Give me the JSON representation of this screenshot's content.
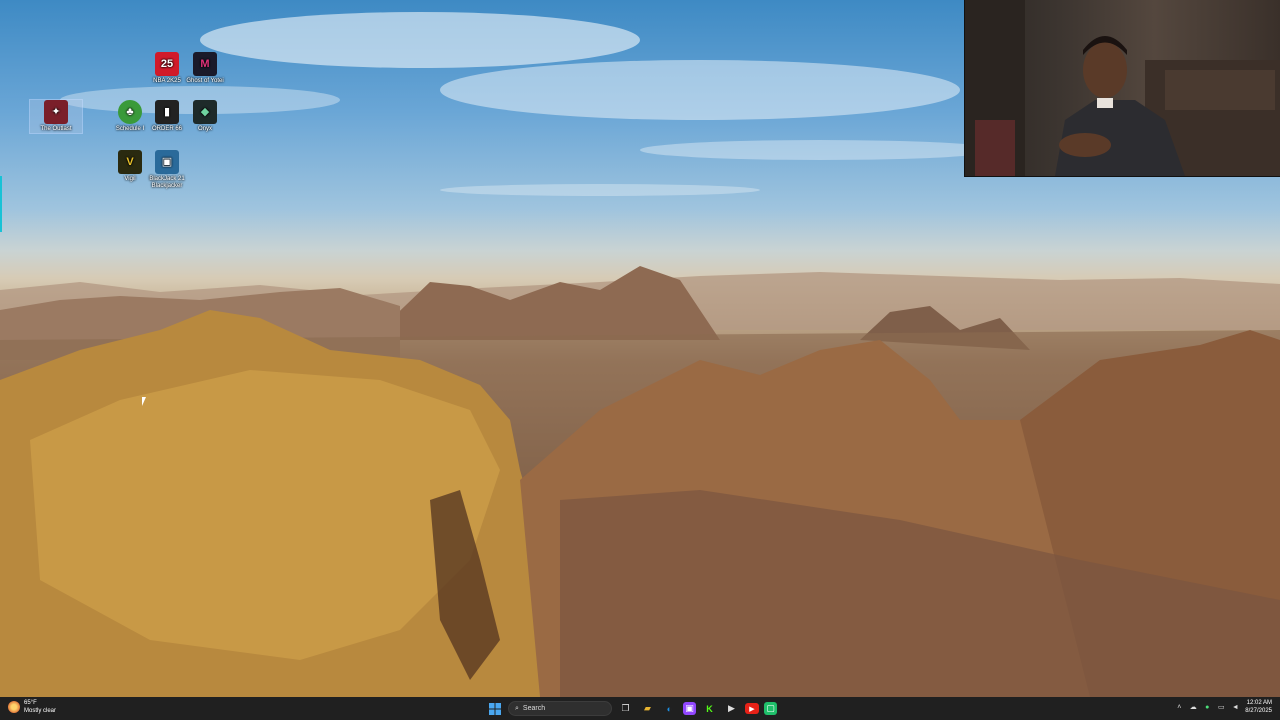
{
  "desktop": {
    "icons": [
      {
        "id": "nba2k25",
        "label": "NBA 2K25",
        "glyph": "25",
        "color": "#d11a2a"
      },
      {
        "id": "ghost",
        "label": "Ghost of Yotei",
        "glyph": "M",
        "color": "#1a1a2a"
      },
      {
        "id": "the-outlast",
        "label": "The Outlast",
        "glyph": "✦",
        "color": "#7a1f2a"
      },
      {
        "id": "schedule",
        "label": "Schedule I",
        "glyph": "♣",
        "color": "#3a9a3a"
      },
      {
        "id": "order66",
        "label": "ORDER 66",
        "glyph": "▮",
        "color": "#222"
      },
      {
        "id": "onyx",
        "label": "Onyx",
        "glyph": "◆",
        "color": "#1e2a2a"
      },
      {
        "id": "vigil",
        "label": "Vigil",
        "glyph": "V",
        "color": "#2a2a10"
      },
      {
        "id": "blackjack",
        "label": "BlackJack 21 Blackjacker",
        "glyph": "▣",
        "color": "#2a6a9a"
      }
    ]
  },
  "taskbar": {
    "weather": {
      "temp": "65°F",
      "condition": "Mostly clear"
    },
    "search_placeholder": "Search",
    "pinned": [
      {
        "id": "task-view",
        "glyph": "❐",
        "color": "#3a3a3a",
        "fg": "#ddd"
      },
      {
        "id": "file-explorer",
        "glyph": "▰",
        "color": "#e8b430",
        "fg": "#e8b430"
      },
      {
        "id": "edge",
        "glyph": "◐",
        "color": "#1d8ee0",
        "fg": "#1d8ee0"
      },
      {
        "id": "twitch",
        "glyph": "▣",
        "color": "#9146ff",
        "fg": "#fff"
      },
      {
        "id": "kick",
        "glyph": "K",
        "color": "#202020",
        "fg": "#53fc18"
      },
      {
        "id": "media",
        "glyph": "▶",
        "color": "#202020",
        "fg": "#ddd"
      },
      {
        "id": "youtube",
        "glyph": "▶",
        "color": "#e62117",
        "fg": "#fff"
      },
      {
        "id": "green-app",
        "glyph": "▢",
        "color": "#1fbf6a",
        "fg": "#fff"
      }
    ],
    "clock": {
      "time": "12:02 AM",
      "date": "8/27/2025"
    }
  },
  "colors": {
    "taskbar_bg": "#202020",
    "accent": "#18c2d6",
    "start_blue": "#4aa7f0"
  }
}
